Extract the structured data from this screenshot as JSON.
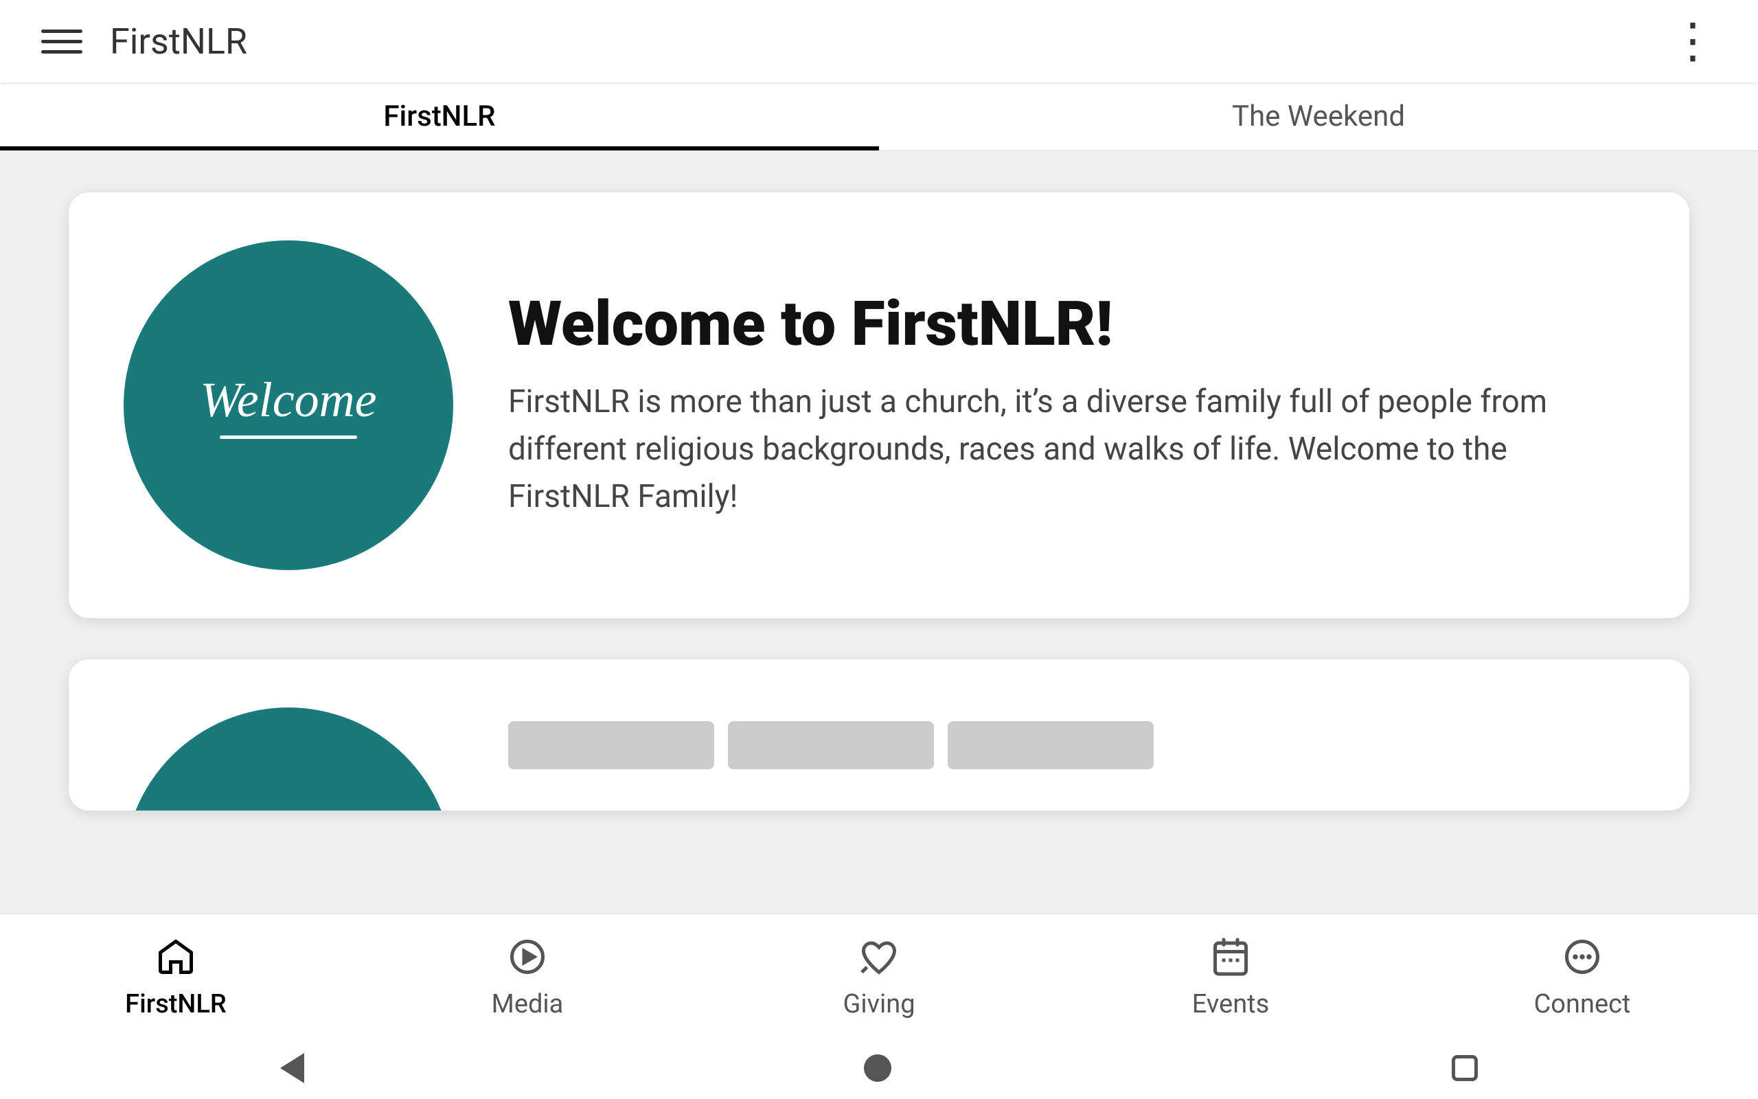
{
  "appBar": {
    "title": "FirstNLR",
    "menuIconLabel": "menu",
    "moreIconLabel": "more options"
  },
  "tabs": [
    {
      "id": "firstnlr",
      "label": "FirstNLR",
      "active": true
    },
    {
      "id": "weekend",
      "label": "The Weekend",
      "active": false
    }
  ],
  "welcomeCard": {
    "circleText": "Welcome",
    "title": "Welcome to FirstNLR!",
    "description": "FirstNLR is more than just a church, it’s a diverse family full of people from different religious backgrounds, races and walks of life. Welcome to the FirstNLR Family!"
  },
  "secondCard": {
    "partialVisible": true
  },
  "bottomNav": {
    "items": [
      {
        "id": "firstnlr",
        "label": "FirstNLR",
        "icon": "home",
        "active": true
      },
      {
        "id": "media",
        "label": "Media",
        "icon": "play-circle",
        "active": false
      },
      {
        "id": "giving",
        "label": "Giving",
        "icon": "heart-hand",
        "active": false
      },
      {
        "id": "events",
        "label": "Events",
        "icon": "calendar",
        "active": false
      },
      {
        "id": "connect",
        "label": "Connect",
        "icon": "chat-bubble",
        "active": false
      }
    ]
  },
  "systemNav": {
    "back": "back",
    "home": "home",
    "overview": "overview"
  }
}
